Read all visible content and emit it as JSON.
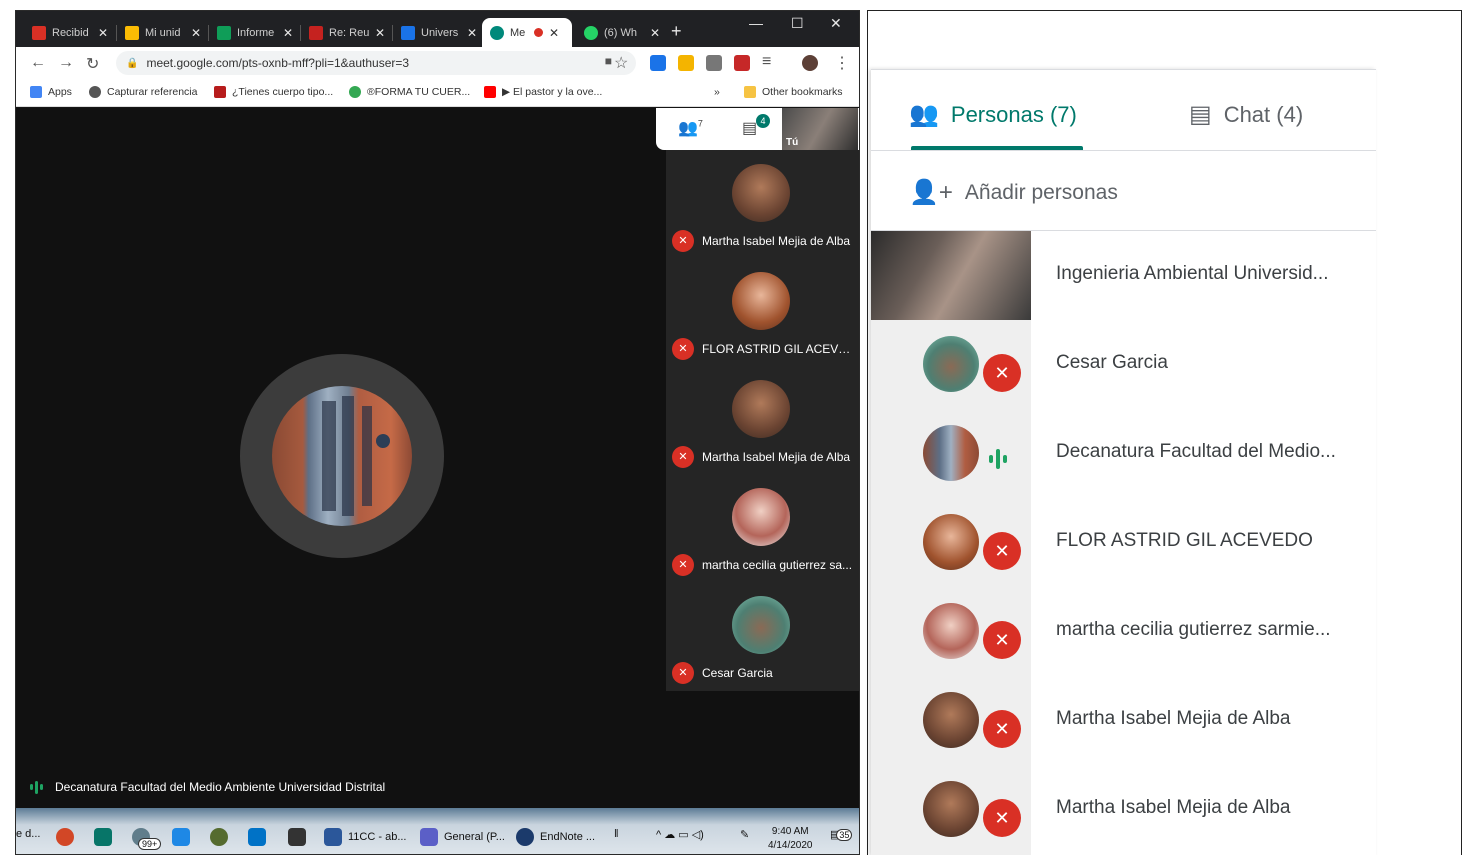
{
  "browser": {
    "tabs": [
      {
        "label": "Recibid",
        "icon": "gmail-icon",
        "color": "#d93025"
      },
      {
        "label": "Mi unid",
        "icon": "drive-icon",
        "color": "#fbbc04"
      },
      {
        "label": "Informe",
        "icon": "sheets-icon",
        "color": "#0f9d58"
      },
      {
        "label": "Re: Reu",
        "icon": "mail-icon",
        "color": "#c5221f"
      },
      {
        "label": "Univers",
        "icon": "calendar-icon",
        "color": "#1a73e8"
      },
      {
        "label": "Me",
        "icon": "meet-icon",
        "color": "#00897b"
      },
      {
        "label": "(6) Wh",
        "icon": "whatsapp-icon",
        "color": "#25d366"
      }
    ],
    "url": "meet.google.com/pts-oxnb-mff?pli=1&authuser=3",
    "bookmarks": [
      {
        "label": "Apps",
        "color": "#4285f4"
      },
      {
        "label": "Capturar referencia",
        "color": "#555555"
      },
      {
        "label": "¿Tienes cuerpo tipo...",
        "color": "#b71c1c"
      },
      {
        "label": "®FORMA TU CUER...",
        "color": "#34a853"
      },
      {
        "label": "▶ El pastor y la ove...",
        "color": "#ff0000"
      }
    ],
    "more_bookmarks": "»",
    "other_bookmarks": "Other bookmarks"
  },
  "meet": {
    "people_count_badge": "7",
    "chat_badge": "4",
    "self_label": "Tú",
    "presenter_caption": "Decanatura Facultad del Medio Ambiente Universidad Distrital",
    "tiles": [
      {
        "name": "Martha Isabel Mejia de Alba"
      },
      {
        "name": "FLOR ASTRID GIL ACEVEDO"
      },
      {
        "name": "Martha Isabel Mejia de Alba"
      },
      {
        "name": "martha cecilia gutierrez sa..."
      },
      {
        "name": "Cesar Garcia"
      }
    ]
  },
  "taskbar": {
    "items": [
      {
        "label": "",
        "color": "#d24726"
      },
      {
        "label": "",
        "color": "#077568"
      },
      {
        "label": "",
        "color": "#2b579a"
      },
      {
        "label": "",
        "color": "#1e88e5"
      },
      {
        "label": "11CC - ab...",
        "color": "#2b579a"
      },
      {
        "label": "General (P...",
        "color": "#5b5fc7"
      },
      {
        "label": "EndNote ...",
        "color": "#1b3a6b"
      }
    ],
    "left_cut": "e d...",
    "badge": "99+",
    "time": "9:40 AM",
    "date": "4/14/2020",
    "notif_count": "35"
  },
  "panel": {
    "tab_people": "Personas (7)",
    "tab_chat": "Chat (4)",
    "add_people": "Añadir personas",
    "participants": [
      {
        "name": "Ingenieria Ambiental Universid...",
        "status": "video"
      },
      {
        "name": "Cesar Garcia",
        "status": "muted"
      },
      {
        "name": "Decanatura Facultad del Medio...",
        "status": "speaking"
      },
      {
        "name": "FLOR ASTRID GIL ACEVEDO",
        "status": "muted"
      },
      {
        "name": "martha cecilia gutierrez sarmie...",
        "status": "muted"
      },
      {
        "name": "Martha Isabel Mejia de Alba",
        "status": "muted"
      },
      {
        "name": "Martha Isabel Mejia de Alba",
        "status": "muted"
      }
    ]
  },
  "colors": {
    "accent": "#00796b",
    "muted_red": "#d93025",
    "speaking_green": "#1ea362"
  }
}
